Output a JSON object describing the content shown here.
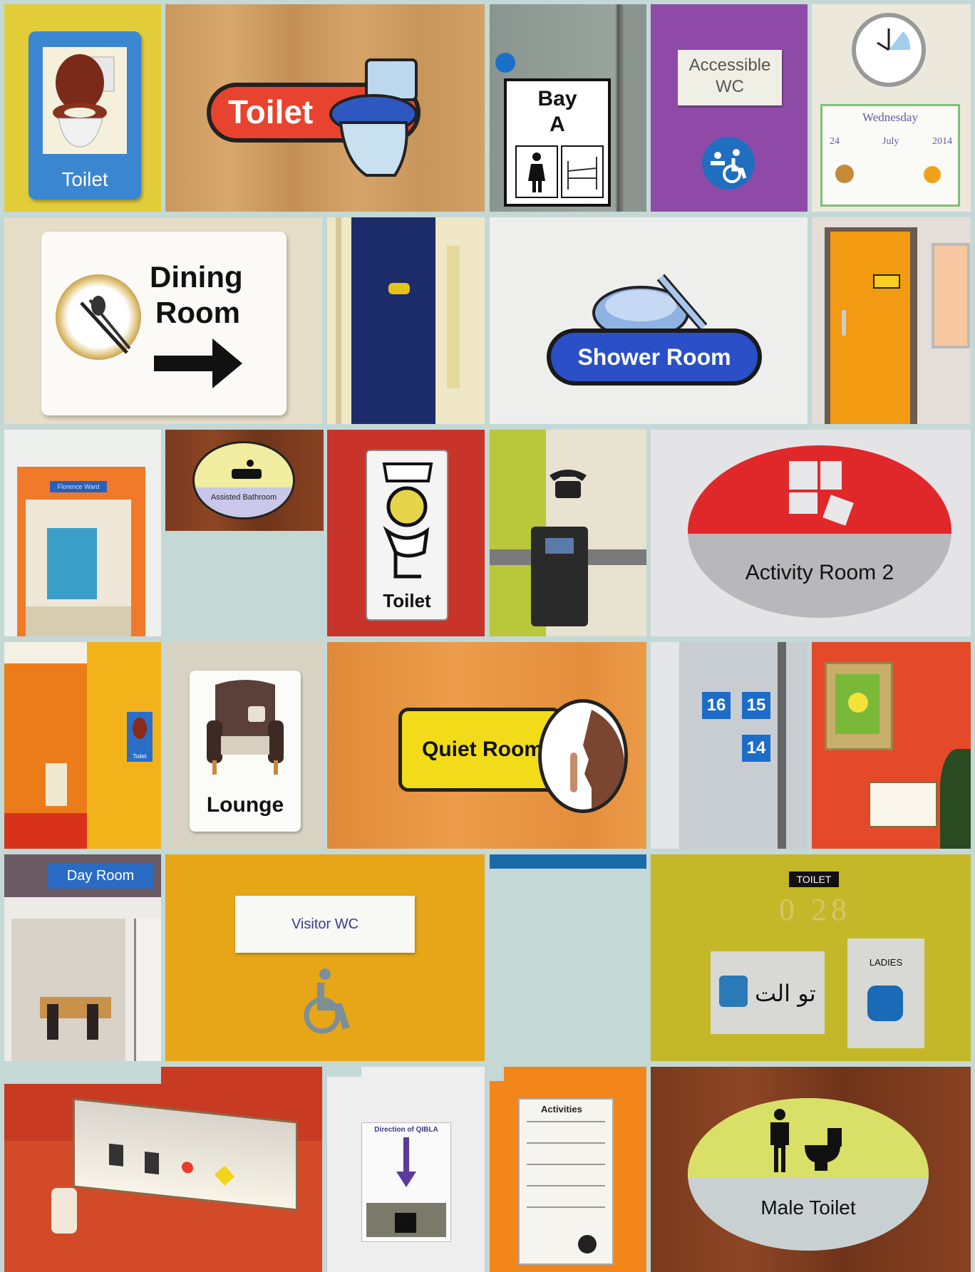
{
  "colors": {
    "background": "#c4d8d6",
    "sign_blue": "#2f6fc6",
    "sign_red": "#e8402e",
    "sign_yellow": "#f2d400",
    "door_orange": "#f29a12",
    "wall_purple": "#8f4aa8"
  },
  "tiles": {
    "toilet_blue_sign": {
      "label": "Toilet"
    },
    "toilet_red_sign": {
      "label": "Toilet"
    },
    "bay_sign": {
      "line1": "Bay",
      "line2": "A"
    },
    "accessible_wc": {
      "line1": "Accessible",
      "line2": "WC"
    },
    "calendar": {
      "day": "Wednesday",
      "date": "24",
      "month": "July",
      "year": "2014"
    },
    "dining_room": {
      "line1": "Dining",
      "line2": "Room"
    },
    "shower_room": {
      "label": "Shower Room"
    },
    "ward_corridor": {
      "label": "Florence Ward"
    },
    "assisted_bathroom": {
      "label": "Assisted Bathroom"
    },
    "toilet_white_sign": {
      "label": "Toilet"
    },
    "activity_room": {
      "label": "Activity Room 2"
    },
    "wet_room": {
      "label": "Toilet"
    },
    "lounge": {
      "label": "Lounge"
    },
    "quiet_room": {
      "label": "Quiet Room"
    },
    "room_numbers": {
      "n1": "16",
      "n2": "15",
      "n3": "14"
    },
    "day_room": {
      "label": "Day Room"
    },
    "visitor_wc": {
      "label": "Visitor WC"
    },
    "arabic_toilet": {
      "badge": "TOILET",
      "number": "0 28",
      "arabic": "تو الت",
      "ladies": "LADIES"
    },
    "qibla": {
      "title": "Direction of QIBLA"
    },
    "activities": {
      "title": "Activities"
    },
    "male_toilet": {
      "label": "Male Toilet"
    }
  }
}
